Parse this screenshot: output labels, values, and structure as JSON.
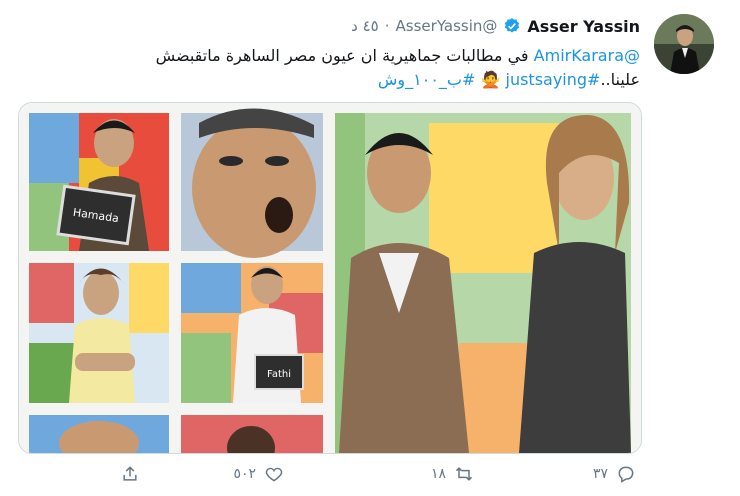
{
  "tweet": {
    "author_name": "Asser Yassin",
    "handle": "@AsserYassin",
    "separator": "·",
    "time": "٤٥ د",
    "mention": "@AmirKarara",
    "text_line1": " في مطالبات جماهيرية ان عيون مصر الساهرة ماتقبضش",
    "text_line2_prefix": "علينا..",
    "hashtag1": "#justsaying",
    "emoji": "🙅",
    "hashtag2": "#ب_١٠٠_وش"
  },
  "media": {
    "card_labels": [
      "Hamada",
      "Fathi"
    ]
  },
  "actions": {
    "reply_count": "٣٧",
    "retweet_count": "١٨",
    "like_count": "٥٠٢"
  },
  "colors": {
    "link": "#1b95e0",
    "muted": "#657786",
    "verified": "#1da1f2"
  }
}
